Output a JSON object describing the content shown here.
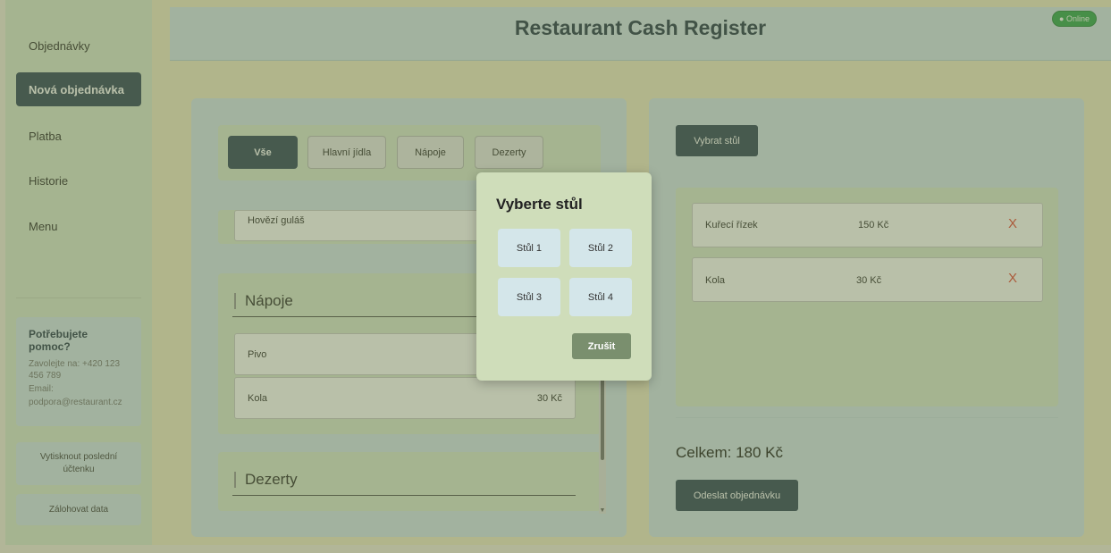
{
  "sidebar": {
    "items": [
      {
        "label": "Objednávky"
      },
      {
        "label": "Nová objednávka"
      },
      {
        "label": "Platba"
      },
      {
        "label": "Historie"
      },
      {
        "label": "Menu"
      }
    ],
    "help": {
      "title": "Potřebujete pomoc?",
      "phone": "Zavolejte na: +420 123 456 789",
      "email_label": "Email:",
      "email": "podpora@restaurant.cz"
    },
    "print_button": "Vytisknout poslední účtenku",
    "backup_button": "Zálohovat data"
  },
  "header": {
    "title": "Restaurant Cash Register",
    "status": "Online"
  },
  "menu_panel": {
    "filters": [
      "Vše",
      "Hlavní jídla",
      "Nápoje",
      "Dezerty"
    ],
    "visible_main_item": "Hovězí guláš",
    "drinks": {
      "title": "Nápoje",
      "items": [
        {
          "name": "Pivo",
          "price": ""
        },
        {
          "name": "Kola",
          "price": "30 Kč"
        }
      ]
    },
    "desserts": {
      "title": "Dezerty"
    }
  },
  "order_panel": {
    "select_table_button": "Vybrat stůl",
    "items": [
      {
        "name": "Kuřecí řízek",
        "price": "150 Kč",
        "remove": "X"
      },
      {
        "name": "Kola",
        "price": "30 Kč",
        "remove": "X"
      }
    ],
    "total": "Celkem: 180 Kč",
    "submit_button": "Odeslat objednávku"
  },
  "modal": {
    "title": "Vyberte stůl",
    "tables": [
      "Stůl 1",
      "Stůl 2",
      "Stůl 3",
      "Stůl 4"
    ],
    "cancel": "Zrušit"
  },
  "colors": {
    "primary": "#34495e",
    "online": "#35a853",
    "remove": "#e74c3c"
  }
}
